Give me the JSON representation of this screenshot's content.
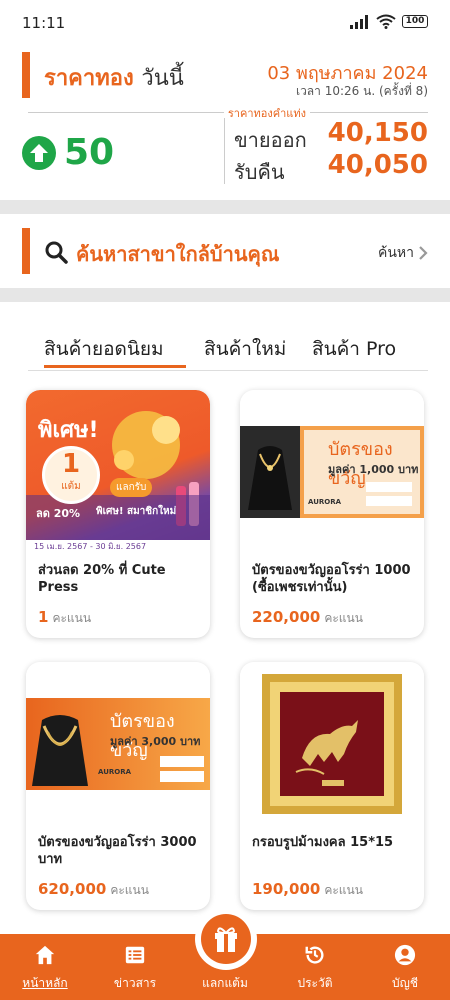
{
  "status_bar": {
    "time": "11:11",
    "battery": "100"
  },
  "gold_price": {
    "title": "ราคาทอง",
    "title_suffix": "วันนี้",
    "date": "03 พฤษภาคม 2024",
    "time_note": "เวลา 10:26 น. (ครั้งที่ 8)",
    "unit_caption": "ราคาทองคำแท่ง",
    "change": "50",
    "sell_label": "ขายออก",
    "sell_value": "40,150",
    "buy_label": "รับคืน",
    "buy_value": "40,050",
    "change_direction": "up",
    "change_color": "#1fa648"
  },
  "search": {
    "label": "ค้นหาสาขาใกล้บ้านคุณ",
    "link": "ค้นหา"
  },
  "tabs": [
    {
      "label": "สินค้ายอดนิยม",
      "active": true
    },
    {
      "label": "สินค้าใหม่",
      "active": false
    },
    {
      "label": "สินค้า Pro",
      "active": false
    }
  ],
  "products": [
    {
      "name": "ส่วนลด 20% ที่ Cute Press",
      "points": "1",
      "points_unit": "คะแนน",
      "image": {
        "badge": "พิเศษ!",
        "one": "1",
        "one_unit": "แต้ม",
        "exchange": "แลกรับ",
        "discount": "ลด 20%",
        "special": "พิเศษ! สมาชิกใหม่",
        "dates": "15 เม.ย. 2567 - 30 มิ.ย. 2567"
      }
    },
    {
      "name": "บัตรของขวัญออโรร่า 1000 (ซื้อเพชรเท่านั้น)",
      "points": "220,000",
      "points_unit": "คะแนน",
      "image": {
        "title": "บัตรของขวัญ",
        "value": "มูลค่า 1,000 บาท",
        "brand": "AURORA"
      }
    },
    {
      "name": "บัตรของขวัญออโรร่า 3000 บาท",
      "points": "620,000",
      "points_unit": "คะแนน",
      "image": {
        "title": "บัตรของขวัญ",
        "value": "มูลค่า 3,000 บาท",
        "brand": "AURORA"
      }
    },
    {
      "name": "กรอบรูปม้ามงคล 15*15",
      "points": "190,000",
      "points_unit": "คะแนน",
      "image": {}
    }
  ],
  "bottom_nav": [
    {
      "label": "หน้าหลัก",
      "icon": "home-icon",
      "active": true
    },
    {
      "label": "ข่าวสาร",
      "icon": "news-icon",
      "active": false
    },
    {
      "label": "แลกแต้ม",
      "icon": "gift-icon",
      "active": false
    },
    {
      "label": "ประวัติ",
      "icon": "history-icon",
      "active": false
    },
    {
      "label": "บัญชี",
      "icon": "account-icon",
      "active": false
    }
  ],
  "colors": {
    "accent": "#e8651e",
    "up": "#1fa648"
  }
}
